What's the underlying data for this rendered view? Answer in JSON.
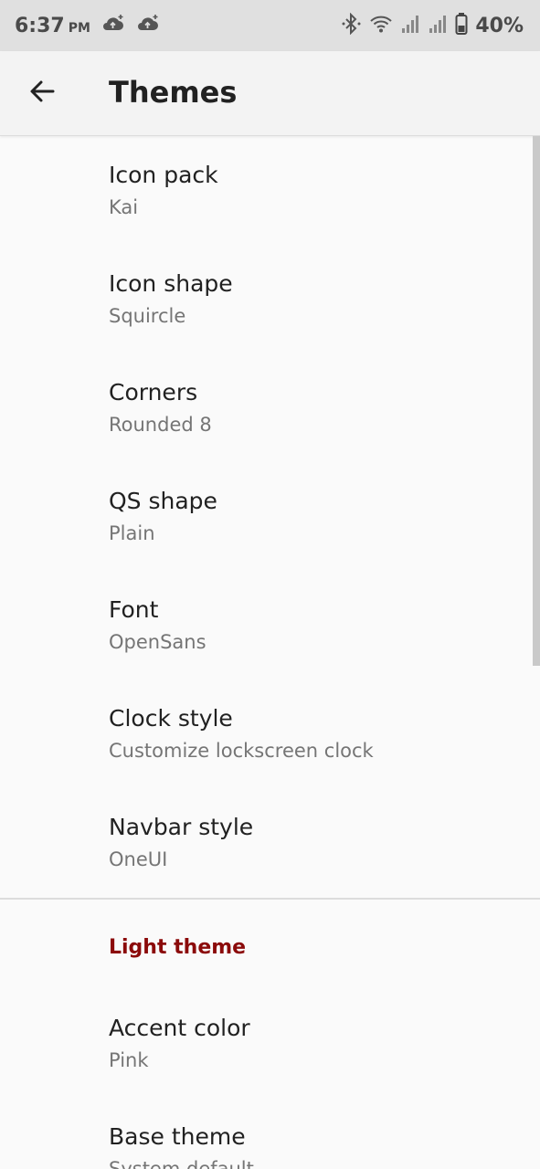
{
  "status_bar": {
    "time": "6:37",
    "ampm": "PM",
    "battery": "40%",
    "icons": [
      "cloud-upload-icon",
      "cloud-upload-icon",
      "bluetooth-icon",
      "wifi-icon",
      "signal-icon",
      "signal-icon",
      "battery-icon"
    ]
  },
  "app_bar": {
    "title": "Themes",
    "back_icon": "arrow-back-icon"
  },
  "preferences": [
    {
      "title": "Icon pack",
      "summary": "Kai"
    },
    {
      "title": "Icon shape",
      "summary": "Squircle"
    },
    {
      "title": "Corners",
      "summary": "Rounded 8"
    },
    {
      "title": "QS shape",
      "summary": "Plain"
    },
    {
      "title": "Font",
      "summary": "OpenSans"
    },
    {
      "title": "Clock style",
      "summary": "Customize lockscreen clock"
    },
    {
      "title": "Navbar style",
      "summary": "OneUI"
    }
  ],
  "light_theme": {
    "category": "Light theme",
    "items": [
      {
        "title": "Accent color",
        "summary": "Pink"
      },
      {
        "title": "Base theme",
        "summary": "System default"
      }
    ]
  },
  "colors": {
    "category_accent": "#8b0a0a",
    "status_bar_bg": "#e0e0e0",
    "app_bar_bg": "#f3f3f3",
    "page_bg": "#fafafa"
  }
}
